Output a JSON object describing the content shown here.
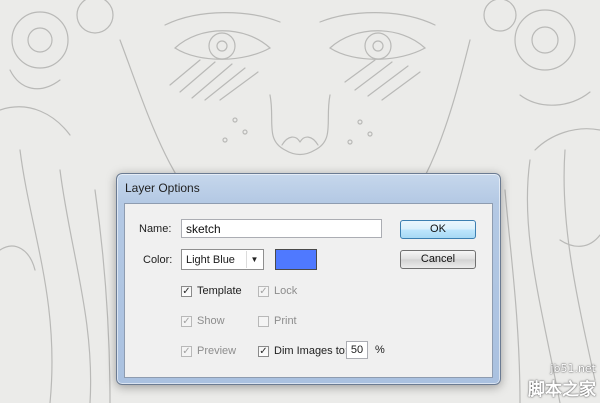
{
  "dialog": {
    "title": "Layer Options",
    "name_label": "Name:",
    "name_value": "sketch",
    "color_label": "Color:",
    "color_value": "Light Blue",
    "color_swatch": "#4f79ff",
    "ok_label": "OK",
    "cancel_label": "Cancel",
    "checkboxes": {
      "template": {
        "label": "Template",
        "checked": true,
        "enabled": true
      },
      "lock": {
        "label": "Lock",
        "checked": true,
        "enabled": false
      },
      "show": {
        "label": "Show",
        "checked": true,
        "enabled": false
      },
      "print": {
        "label": "Print",
        "checked": false,
        "enabled": false
      },
      "preview": {
        "label": "Preview",
        "checked": true,
        "enabled": false
      },
      "dim_images": {
        "label": "Dim Images to:",
        "checked": true,
        "enabled": true
      }
    },
    "dim_value": "50",
    "dim_unit": "%"
  },
  "watermark": {
    "site": "jb51.net",
    "chinese": "脚本之家"
  }
}
